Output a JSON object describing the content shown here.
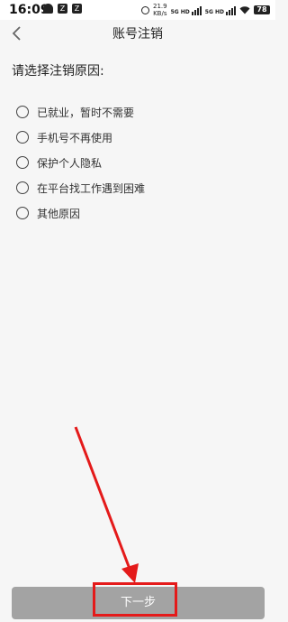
{
  "status_bar": {
    "time": "16:09",
    "notification_badges": [
      "Z",
      "Z"
    ],
    "net_speed_value": "21.9",
    "net_speed_unit": "KB/s",
    "signal_1_label": "5G HD",
    "signal_2_label": "5G HD",
    "battery": "78"
  },
  "header": {
    "title": "账号注销"
  },
  "main": {
    "prompt": "请选择注销原因:",
    "options": [
      {
        "label": "已就业，暂时不需要"
      },
      {
        "label": "手机号不再使用"
      },
      {
        "label": "保护个人隐私"
      },
      {
        "label": "在平台找工作遇到困难"
      },
      {
        "label": "其他原因"
      }
    ]
  },
  "footer": {
    "next_label": "下一步"
  },
  "colors": {
    "button_disabled": "#a3a3a3",
    "annotation": "#e41a1a",
    "background": "#f6f6f6"
  }
}
